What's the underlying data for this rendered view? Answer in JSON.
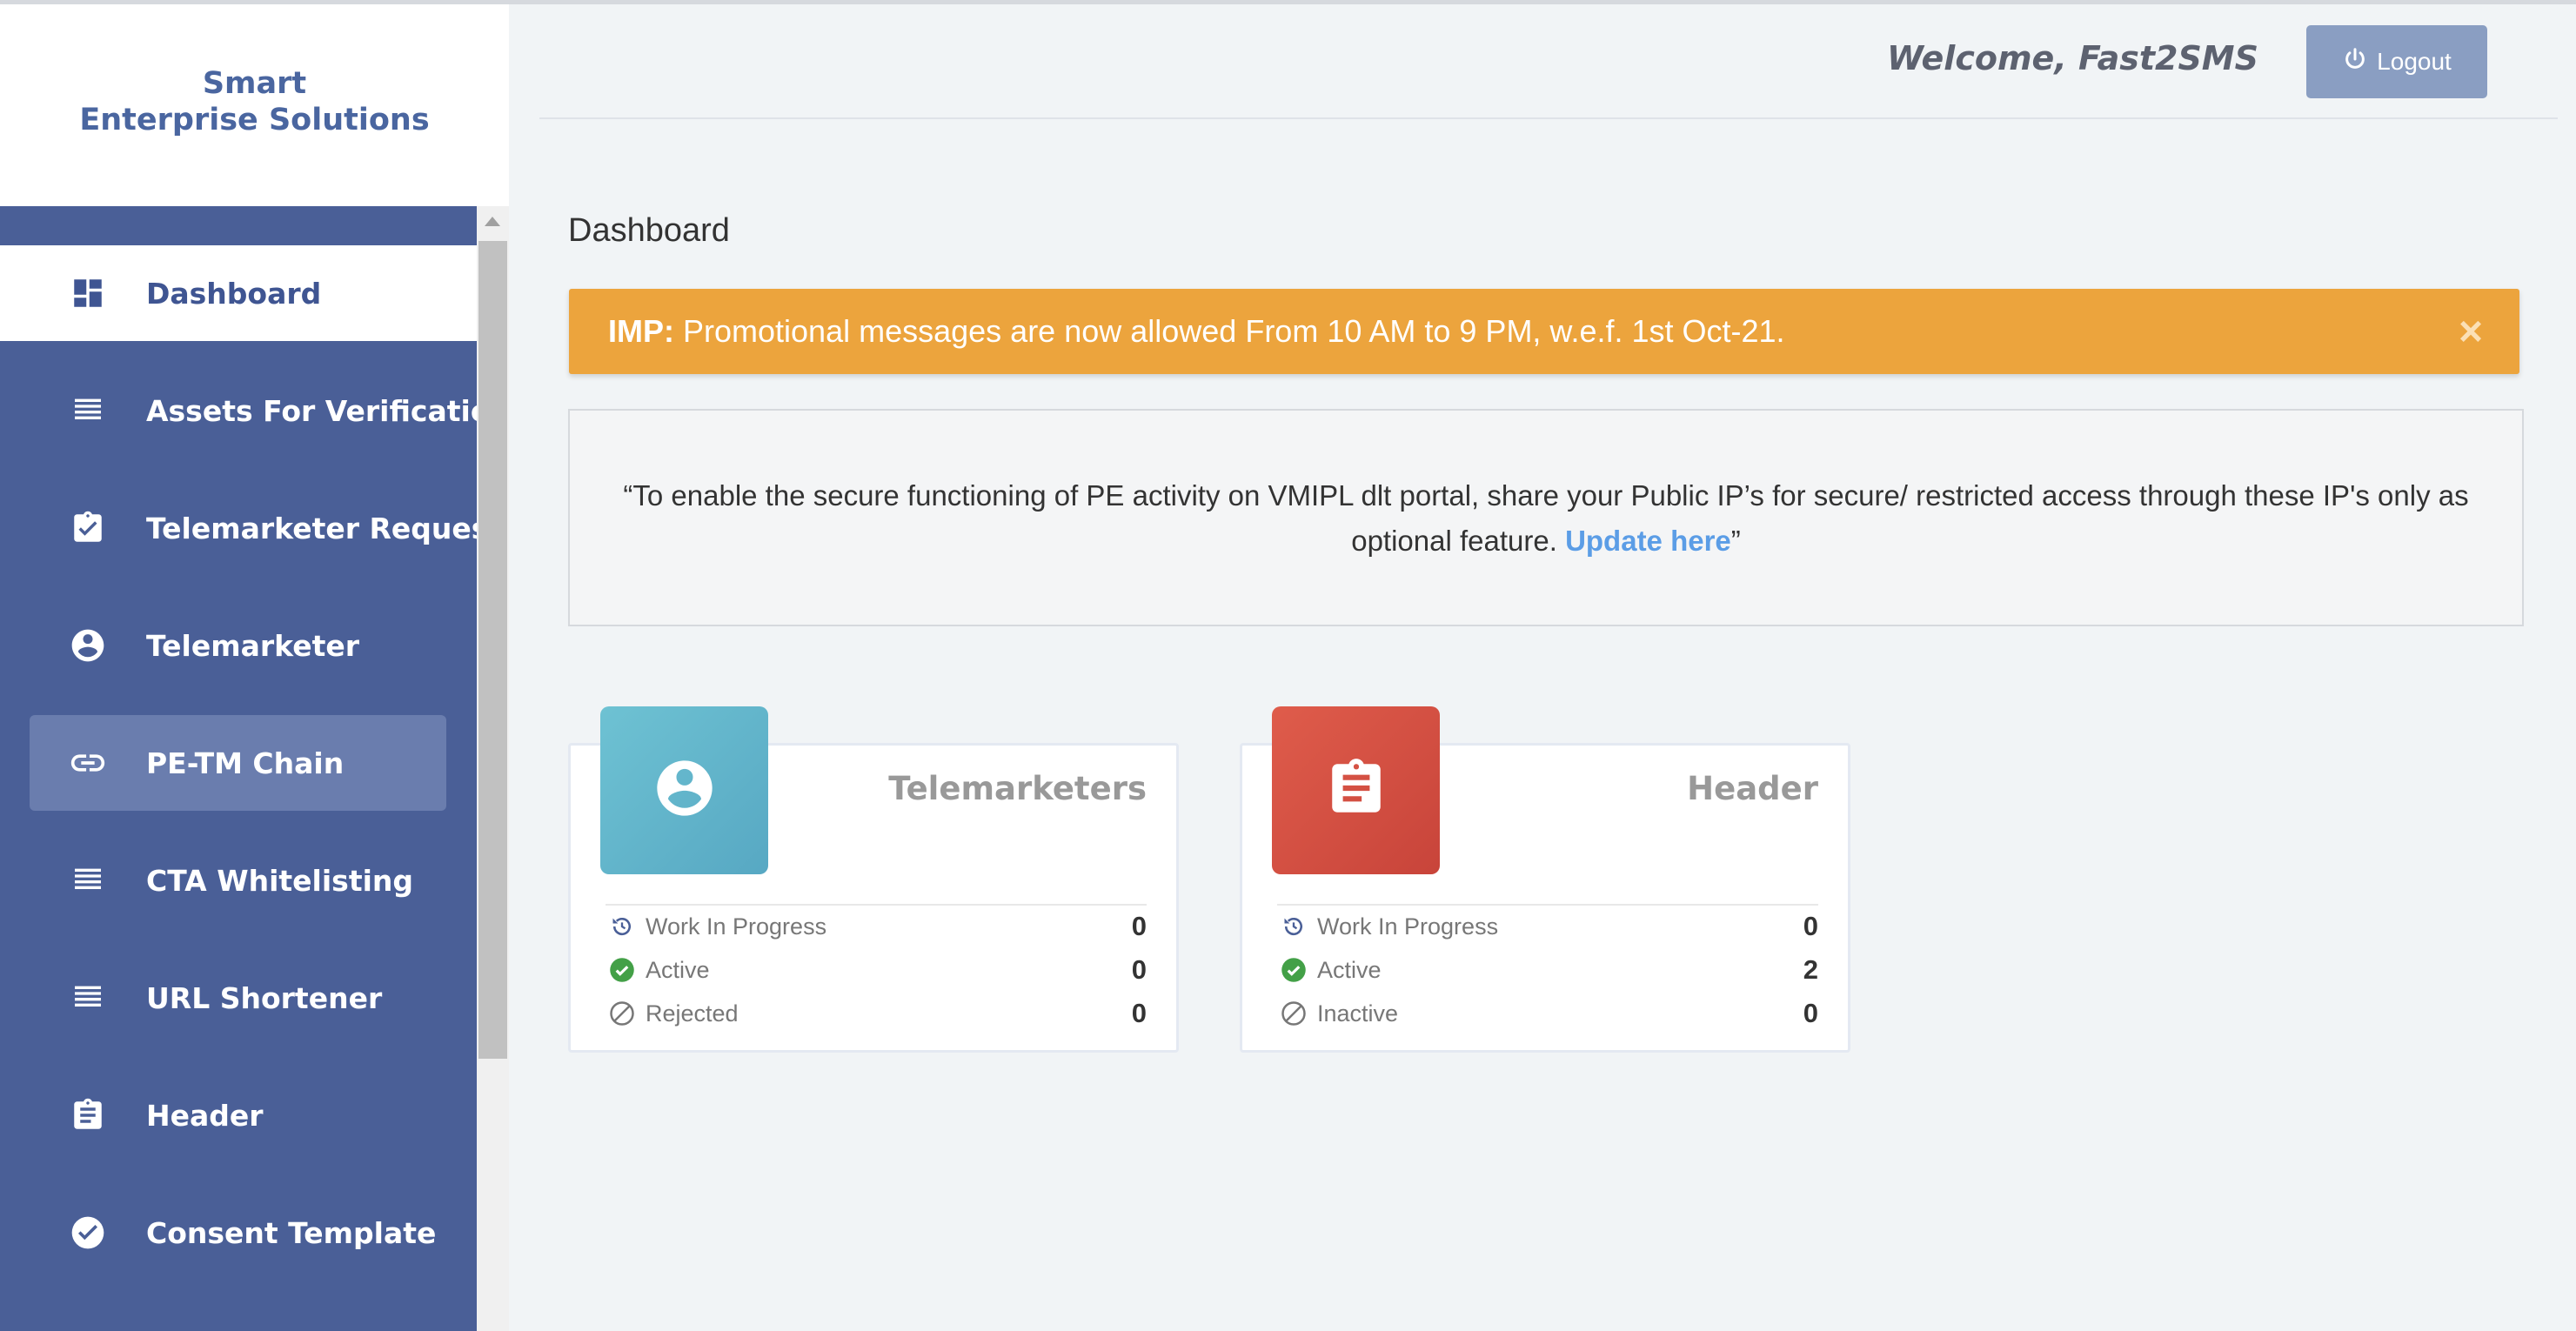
{
  "brand": {
    "line1": "Smart",
    "line2": "Enterprise Solutions"
  },
  "sidebar": {
    "items": [
      {
        "label": "Dashboard",
        "icon": "dashboard-icon",
        "state": "active"
      },
      {
        "label": "Assets For Verification",
        "icon": "list-icon"
      },
      {
        "label": "Telemarketer Request",
        "icon": "clipboard-check-icon"
      },
      {
        "label": "Telemarketer",
        "icon": "user-circle-icon"
      },
      {
        "label": "PE-TM Chain",
        "icon": "link-icon",
        "state": "hover"
      },
      {
        "label": "CTA Whitelisting",
        "icon": "list-icon"
      },
      {
        "label": "URL Shortener",
        "icon": "list-icon"
      },
      {
        "label": "Header",
        "icon": "clipboard-text-icon"
      },
      {
        "label": "Consent Template",
        "icon": "check-circle-icon"
      }
    ]
  },
  "header": {
    "welcome": "Welcome, Fast2SMS",
    "logout_label": "Logout"
  },
  "page": {
    "title": "Dashboard"
  },
  "alert": {
    "prefix": "IMP:",
    "message": " Promotional messages are now allowed From 10 AM to 9 PM, w.e.f. 1st Oct-21.",
    "close": "×"
  },
  "notice": {
    "text": "“To enable the secure functioning of PE activity on VMIPL dlt portal, share your Public IP’s for secure/ restricted access through these IP's only as optional feature. ",
    "link": "Update here",
    "suffix": "”"
  },
  "cards": [
    {
      "title": "Telemarketers",
      "icon": "user-circle-icon",
      "color": "#5fb4c9",
      "stats": [
        {
          "label": "Work In Progress",
          "value": "0",
          "icon": "history-icon"
        },
        {
          "label": "Active",
          "value": "0",
          "icon": "check-circle-icon"
        },
        {
          "label": "Rejected",
          "value": "0",
          "icon": "ban-icon"
        }
      ]
    },
    {
      "title": "Header",
      "icon": "clipboard-text-icon",
      "color": "#d3503f",
      "stats": [
        {
          "label": "Work In Progress",
          "value": "0",
          "icon": "history-icon"
        },
        {
          "label": "Active",
          "value": "2",
          "icon": "check-circle-icon"
        },
        {
          "label": "Inactive",
          "value": "0",
          "icon": "ban-icon"
        }
      ]
    }
  ],
  "colors": {
    "sidebar": "#4a5f97",
    "alert": "#eca43d",
    "link": "#5b9de6",
    "success": "#43a047"
  }
}
